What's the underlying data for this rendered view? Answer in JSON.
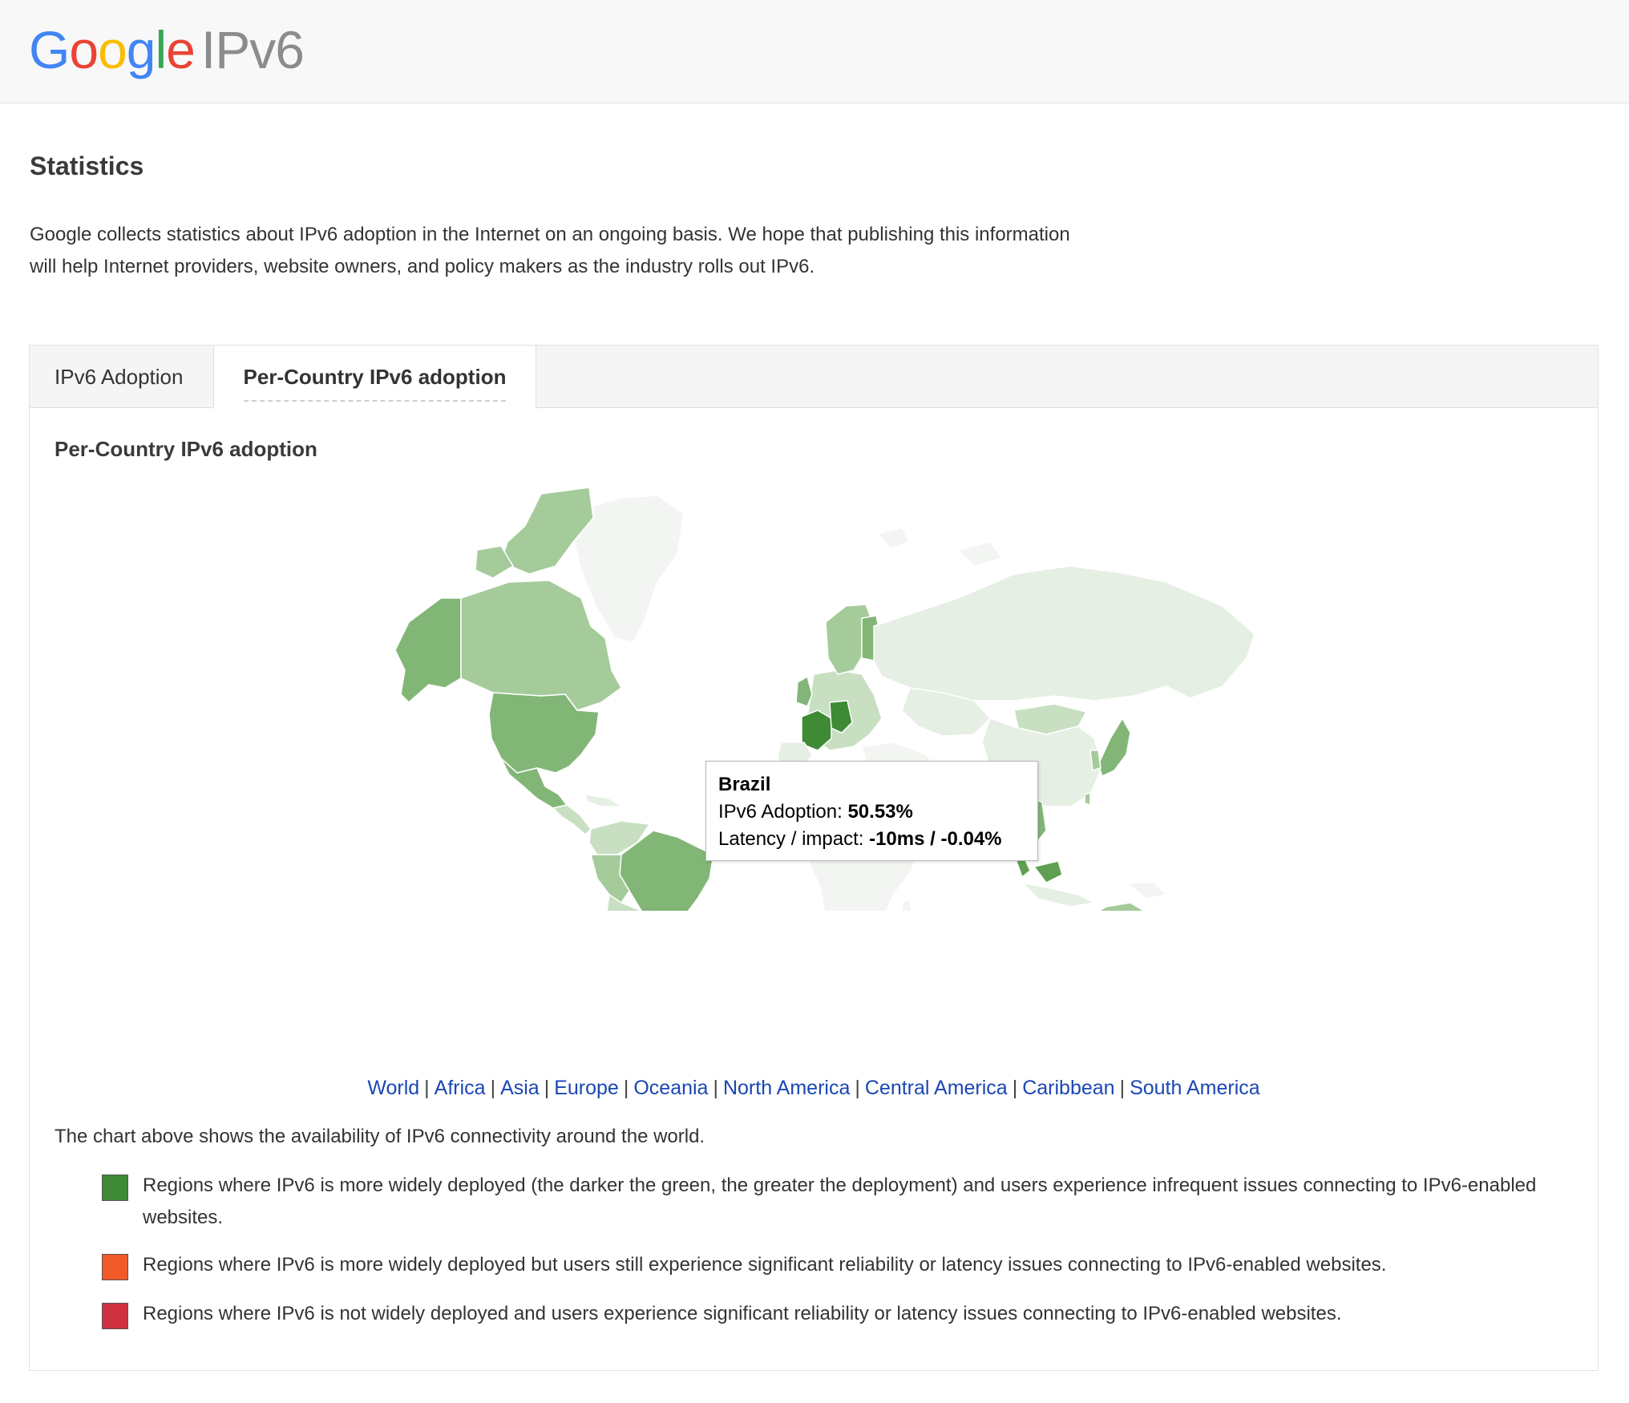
{
  "header": {
    "logo_text": "Google",
    "product": "IPv6"
  },
  "page": {
    "title": "Statistics",
    "intro": "Google collects statistics about IPv6 adoption in the Internet on an ongoing basis. We hope that publishing this information will help Internet providers, website owners, and policy makers as the industry rolls out IPv6."
  },
  "tabs": [
    {
      "label": "IPv6 Adoption",
      "active": false
    },
    {
      "label": "Per-Country IPv6 adoption",
      "active": true
    }
  ],
  "section": {
    "title": "Per-Country IPv6 adoption"
  },
  "tooltip": {
    "country": "Brazil",
    "adoption_label": "IPv6 Adoption:",
    "adoption_value": "50.53%",
    "latency_label": "Latency / impact:",
    "latency_value": "-10ms / -0.04%"
  },
  "regions": [
    "World",
    "Africa",
    "Asia",
    "Europe",
    "Oceania",
    "North America",
    "Central America",
    "Caribbean",
    "South America"
  ],
  "chart_note": "The chart above shows the availability of IPv6 connectivity around the world.",
  "legend": [
    {
      "color": "#3e8a35",
      "text": "Regions where IPv6 is more widely deployed (the darker the green, the greater the deployment) and users experience infrequent issues connecting to IPv6-enabled websites."
    },
    {
      "color": "#f05a28",
      "text": "Regions where IPv6 is more widely deployed but users still experience significant reliability or latency issues connecting to IPv6-enabled websites."
    },
    {
      "color": "#d0313f",
      "text": "Regions where IPv6 is not widely deployed and users experience significant reliability or latency issues connecting to IPv6-enabled websites."
    }
  ],
  "map_colors": {
    "none": "#f3f5f2",
    "very_low": "#e6efe3",
    "low": "#c8dfc2",
    "medium": "#a5cb9b",
    "high": "#82b677",
    "very_high": "#5f9f52",
    "top": "#3e8a35"
  }
}
